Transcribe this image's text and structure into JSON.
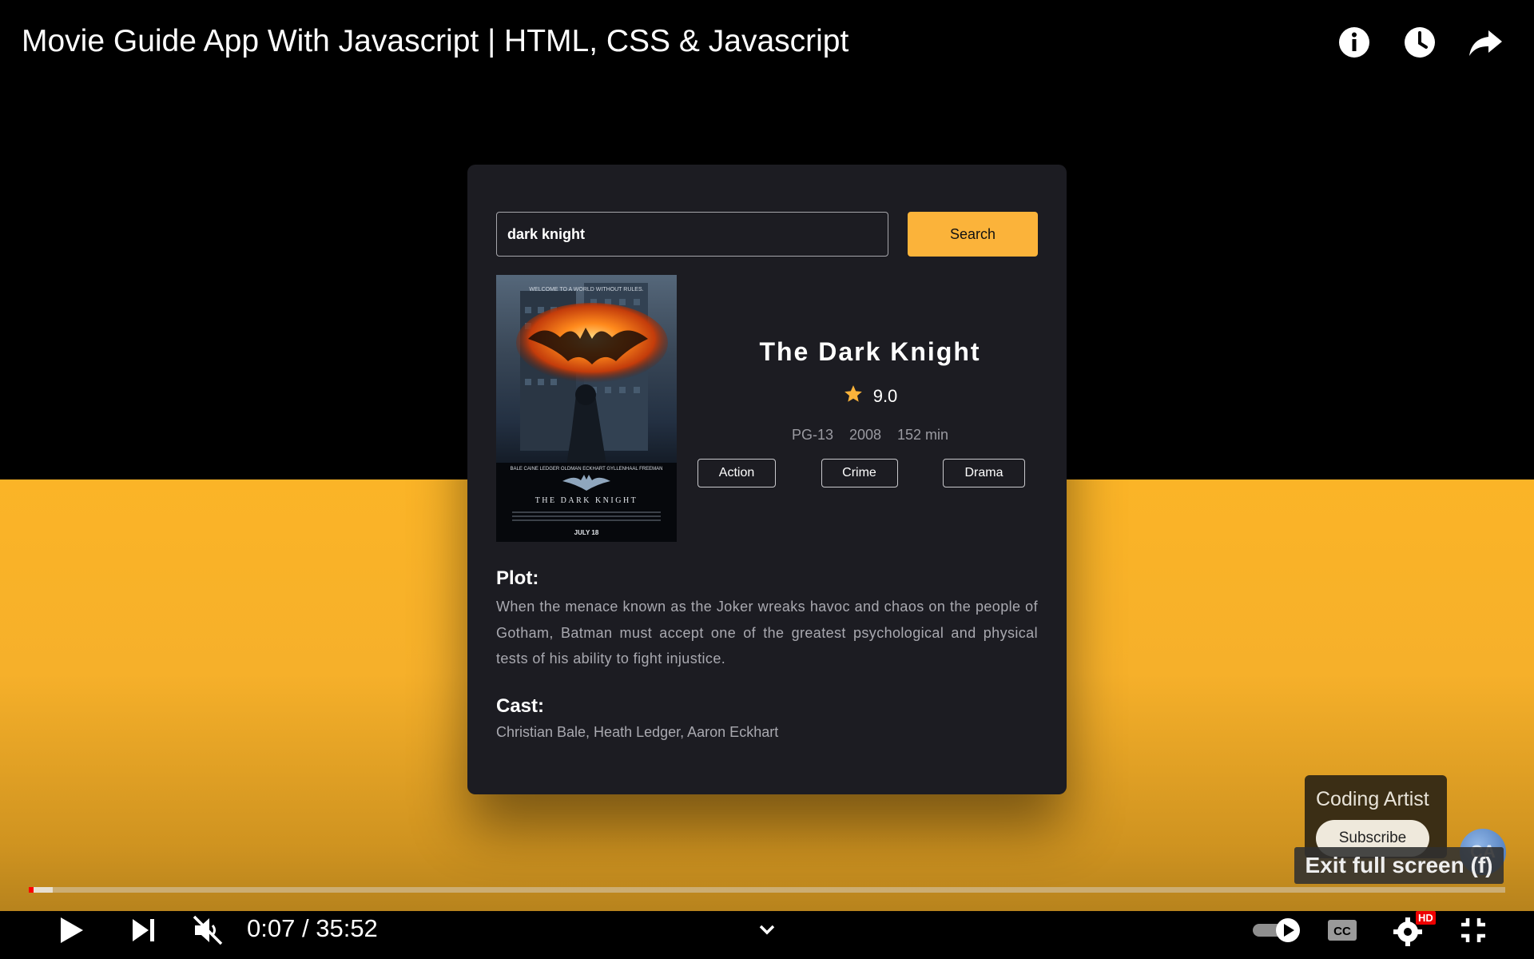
{
  "video": {
    "title": "Movie Guide App With Javascript | HTML, CSS & Javascript",
    "time_current": "0:07",
    "time_separator": "/",
    "time_total": "35:52",
    "played_fraction": 0.0033,
    "buffered_fraction": 0.016
  },
  "top_icons": [
    "info-icon",
    "watch-later-clock-icon",
    "share-icon"
  ],
  "app": {
    "search": {
      "value": "dark knight",
      "button_label": "Search"
    },
    "movie": {
      "title": "The Dark Knight",
      "rating": "9.0",
      "rated": "PG-13",
      "year": "2008",
      "runtime": "152 min",
      "genres": [
        "Action",
        "Crime",
        "Drama"
      ],
      "plot_heading": "Plot:",
      "plot": "When the menace known as the Joker wreaks havoc and chaos on the people of Gotham, Batman must accept one of the greatest psychological and physical tests of his ability to fight injustice.",
      "cast_heading": "Cast:",
      "cast": "Christian Bale, Heath Ledger, Aaron Eckhart",
      "poster": {
        "tagline": "WELCOME TO A WORLD WITHOUT RULES.",
        "credits": "BALE CAINE LEDGER OLDMAN ECKHART GYLLENHAAL FREEMAN",
        "film_title": "THE DARK KNIGHT",
        "date": "JULY 18"
      }
    }
  },
  "channel": {
    "name": "Coding Artist",
    "subscribe_label": "Subscribe",
    "avatar_text": "CA"
  },
  "tooltip": {
    "text": "Exit full screen (f)"
  },
  "badges": {
    "hd": "HD"
  },
  "colors": {
    "accent": "#fbb33a",
    "card": "#1c1c22",
    "progress": "#ff0000"
  }
}
